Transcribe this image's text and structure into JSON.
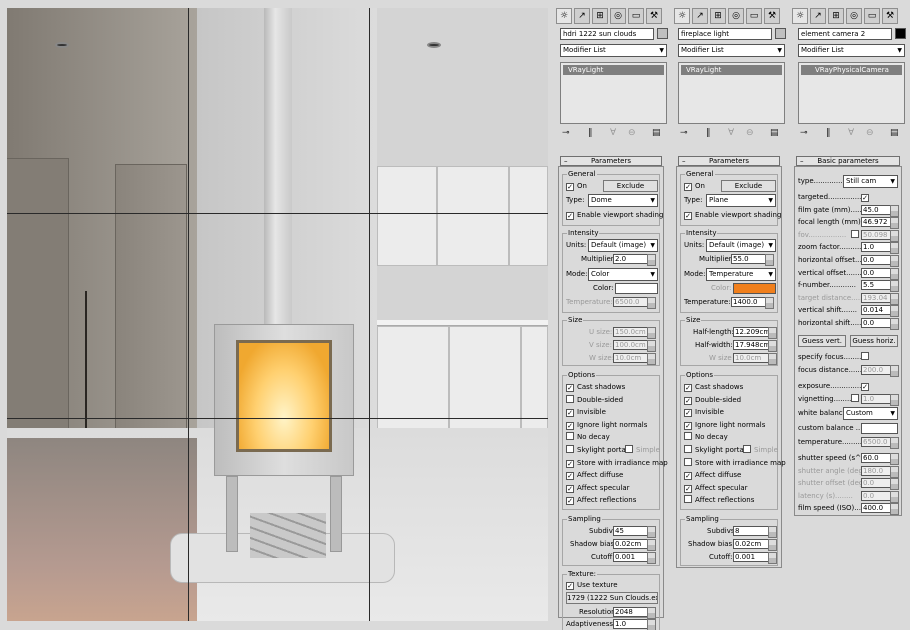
{
  "panels": [
    {
      "name": "hdri 1222 sun clouds",
      "modifier": "Modifier List",
      "stack_item": "VRayLight",
      "header": "Parameters",
      "general": {
        "title": "General",
        "on": "On",
        "exclude": "Exclude",
        "type_label": "Type:",
        "type": "Dome",
        "viewport": "Enable viewport shading"
      },
      "intensity": {
        "title": "Intensity",
        "units_label": "Units:",
        "units": "Default (image)",
        "mult_label": "Multiplier:",
        "mult": "2.0",
        "mode_label": "Mode:",
        "mode": "Color",
        "color_label": "Color:",
        "color": "#ffffff",
        "temp_label": "Temperature:",
        "temp": "6500.0"
      },
      "size": {
        "title": "Size",
        "rows": [
          {
            "label": "U size:",
            "value": "150.0cm"
          },
          {
            "label": "V size:",
            "value": "100.0cm"
          },
          {
            "label": "W size:",
            "value": "10.0cm"
          }
        ]
      },
      "options": {
        "title": "Options",
        "items": [
          {
            "label": "Cast shadows",
            "checked": true
          },
          {
            "label": "Double-sided",
            "checked": false
          },
          {
            "label": "Invisible",
            "checked": true
          },
          {
            "label": "Ignore light normals",
            "checked": true
          },
          {
            "label": "No decay",
            "checked": false
          },
          {
            "label": "Skylight portal",
            "checked": false
          },
          {
            "label": "Store with irradiance map",
            "checked": true
          },
          {
            "label": "Affect diffuse",
            "checked": true
          },
          {
            "label": "Affect specular",
            "checked": true
          },
          {
            "label": "Affect reflections",
            "checked": true
          }
        ],
        "simple": "Simple"
      },
      "sampling": {
        "title": "Sampling",
        "rows": [
          {
            "label": "Subdivs:",
            "value": "45"
          },
          {
            "label": "Shadow bias:",
            "value": "0.02cm"
          },
          {
            "label": "Cutoff:",
            "value": "0.001"
          }
        ]
      },
      "texture": {
        "title": "Texture:",
        "use": "Use texture",
        "map": "1729 (1222 Sun Clouds.exr)",
        "res_label": "Resolution:",
        "res": "2048",
        "adapt_label": "Adaptiveness:",
        "adapt": "1.0"
      }
    },
    {
      "name": "fireplace light",
      "modifier": "Modifier List",
      "stack_item": "VRayLight",
      "header": "Parameters",
      "general": {
        "title": "General",
        "on": "On",
        "exclude": "Exclude",
        "type_label": "Type:",
        "type": "Plane",
        "viewport": "Enable viewport shading"
      },
      "intensity": {
        "title": "Intensity",
        "units_label": "Units:",
        "units": "Default (image)",
        "mult_label": "Multiplier:",
        "mult": "55.0",
        "mode_label": "Mode:",
        "mode": "Temperature",
        "color_label": "Color:",
        "color": "#f07f1c",
        "temp_label": "Temperature:",
        "temp": "1400.0"
      },
      "size": {
        "title": "Size",
        "rows": [
          {
            "label": "Half-length:",
            "value": "12.209cm"
          },
          {
            "label": "Half-width:",
            "value": "17.948cm"
          },
          {
            "label": "W size",
            "value": "10.0cm"
          }
        ]
      },
      "options": {
        "title": "Options",
        "items": [
          {
            "label": "Cast shadows",
            "checked": true
          },
          {
            "label": "Double-sided",
            "checked": true
          },
          {
            "label": "Invisible",
            "checked": true
          },
          {
            "label": "Ignore light normals",
            "checked": true
          },
          {
            "label": "No decay",
            "checked": false
          },
          {
            "label": "Skylight portal",
            "checked": false
          },
          {
            "label": "Store with irradiance map",
            "checked": false
          },
          {
            "label": "Affect diffuse",
            "checked": true
          },
          {
            "label": "Affect specular",
            "checked": true
          },
          {
            "label": "Affect reflections",
            "checked": false
          }
        ],
        "simple": "Simple"
      },
      "sampling": {
        "title": "Sampling",
        "rows": [
          {
            "label": "Subdivs:",
            "value": "8"
          },
          {
            "label": "Shadow bias:",
            "value": "0.02cm"
          },
          {
            "label": "Cutoff:",
            "value": "0.001"
          }
        ]
      }
    }
  ],
  "camera": {
    "name": "element camera 2",
    "modifier": "Modifier List",
    "stack_item": "VRayPhysicalCamera",
    "header": "Basic parameters",
    "type_label": "type..............",
    "type": "Still cam",
    "rows1": [
      {
        "label": "targeted...............",
        "kind": "check",
        "checked": true
      },
      {
        "label": "film gate (mm).......",
        "kind": "spin",
        "value": "45.0"
      },
      {
        "label": "focal length (mm)...",
        "kind": "spin",
        "value": "46.972"
      },
      {
        "label": "fov.................",
        "kind": "checkspin",
        "value": "50.098",
        "dim": true
      },
      {
        "label": "zoom factor..........",
        "kind": "spin",
        "value": "1.0"
      },
      {
        "label": "horizontal offset.....",
        "kind": "spin",
        "value": "0.0"
      },
      {
        "label": "vertical offset.......",
        "kind": "spin",
        "value": "0.0"
      },
      {
        "label": "f-number............",
        "kind": "spin",
        "value": "5.5"
      },
      {
        "label": "target distance.....",
        "kind": "spin",
        "value": "193.04",
        "dim": true
      },
      {
        "label": "vertical shift.......",
        "kind": "spin",
        "value": "0.014"
      },
      {
        "label": "horizontal shift......",
        "kind": "spin",
        "value": "0.0"
      }
    ],
    "guess_vert": "Guess vert.",
    "guess_horiz": "Guess horiz.",
    "specify_focus": "specify focus.........",
    "focus_label": "focus distance........",
    "focus": "200.0",
    "exposure": "exposure..............",
    "vignetting": "vignetting...........",
    "vignetting_value": "1.0",
    "wb_label": "white balance",
    "wb": "Custom",
    "custom_balance": "custom balance .......",
    "temp_label": "temperature...........",
    "temp": "6500.0",
    "rows2": [
      {
        "label": "shutter speed (s^-1",
        "value": "60.0"
      },
      {
        "label": "shutter angle (deg)",
        "value": "180.0",
        "dim": true
      },
      {
        "label": "shutter offset (deg)",
        "value": "0.0",
        "dim": true
      },
      {
        "label": "latency (s)........",
        "value": "0.0",
        "dim": true
      },
      {
        "label": "film speed (ISO).....",
        "value": "400.0"
      }
    ]
  },
  "icons": [
    "sun-icon",
    "curve-icon",
    "hierarchy-icon",
    "motion-icon",
    "display-icon",
    "hammer-icon",
    "pin-icon",
    "show-end-icon",
    "unique-icon",
    "remove-icon",
    "configure-icon"
  ]
}
